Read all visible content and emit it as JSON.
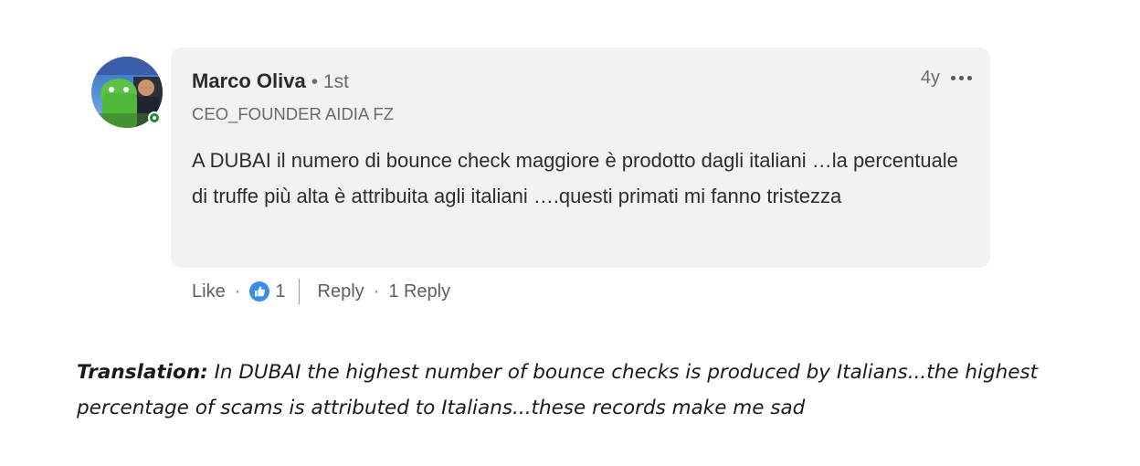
{
  "comment": {
    "author_name": "Marco Oliva",
    "connection_degree": "• 1st",
    "headline": "CEO_FOUNDER AIDIA FZ",
    "timestamp": "4y",
    "more_icon": "more-horizontal-icon",
    "text": "A DUBAI il numero di bounce check maggiore è prodotto dagli italiani …la percentuale di truffe più alta è attribuita agli italiani ….questi primati mi fanno tristezza",
    "status": "online"
  },
  "actions": {
    "like_label": "Like",
    "dot_separator": "·",
    "reaction_icon": "thumbs-up-icon",
    "reaction_count": "1",
    "reply_label": "Reply",
    "replies_count_label": "1 Reply"
  },
  "translation": {
    "label": "Translation",
    "colon": ":",
    "text": " In DUBAI the highest number of bounce checks is produced by Italians...the highest percentage of scams is attributed to Italians...these records make me sad"
  },
  "colors": {
    "bubble_bg": "#f2f2f2",
    "reaction_blue": "#378fe9",
    "presence_green": "#1b8a3a"
  }
}
